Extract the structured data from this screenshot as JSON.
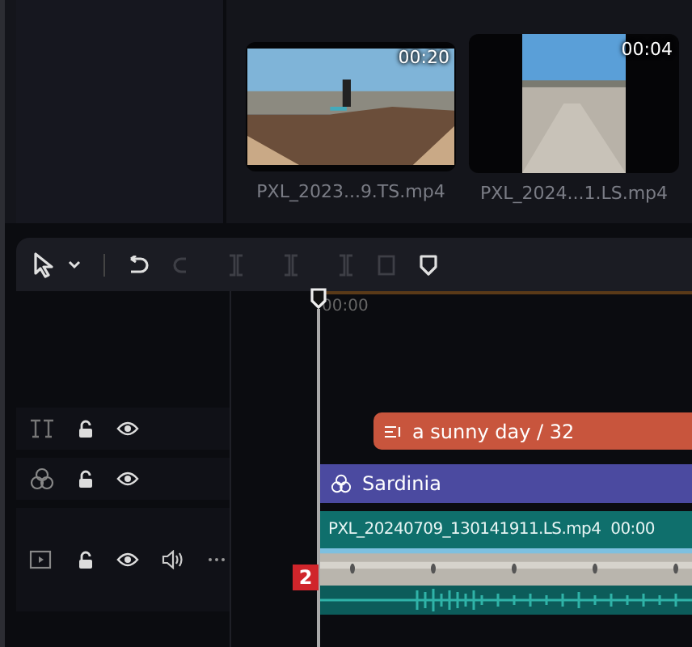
{
  "media": [
    {
      "name": "PXL_2023...9.TS.mp4",
      "duration": "00:20",
      "kind": "landscape"
    },
    {
      "name": "PXL_2024...1.LS.mp4",
      "duration": "00:04",
      "kind": "portrait"
    }
  ],
  "toolbar": [
    {
      "kind": "select",
      "disabled": false
    },
    {
      "kind": "dropdown",
      "disabled": false
    },
    {
      "kind": "undo",
      "disabled": false
    },
    {
      "kind": "redo",
      "disabled": true
    },
    {
      "kind": "split",
      "disabled": true
    },
    {
      "kind": "split",
      "disabled": true
    },
    {
      "kind": "split",
      "disabled": true
    },
    {
      "kind": "delete",
      "disabled": true
    },
    {
      "kind": "marker",
      "disabled": false
    }
  ],
  "ruler": {
    "time": "00:00"
  },
  "tracks": [
    {
      "kind": "text",
      "audio": false,
      "more": false,
      "clip": {
        "label": "a sunny day / 32",
        "color": "#c8553d"
      }
    },
    {
      "kind": "effect",
      "audio": false,
      "more": false,
      "clip": {
        "label": "Sardinia",
        "color": "#4b4aa0"
      }
    },
    {
      "kind": "video",
      "audio": true,
      "more": true,
      "clip": {
        "label": "PXL_20240709_130141911.LS.mp4",
        "time": "00:00",
        "color": "#0f6f6c"
      }
    }
  ],
  "badge": "2"
}
